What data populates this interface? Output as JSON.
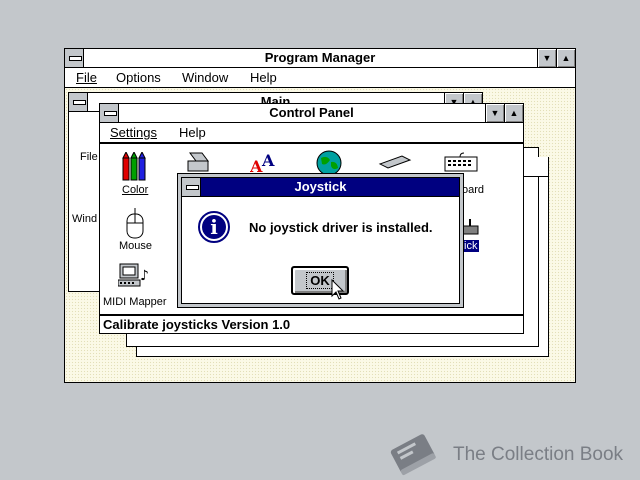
{
  "program_manager": {
    "title": "Program Manager",
    "menu": [
      "File",
      "Options",
      "Window",
      "Help"
    ]
  },
  "main_group": {
    "title": "Main",
    "partial_labels": [
      "File",
      "Wind"
    ]
  },
  "control_panel": {
    "title": "Control Panel",
    "menu": [
      "Settings",
      "Help"
    ],
    "icons": [
      "Color",
      "Mouse",
      "MIDI Mapper",
      "Keyboard",
      "Joystick"
    ],
    "status": "Calibrate joysticks Version 1.0"
  },
  "dialog": {
    "title": "Joystick",
    "message": "No joystick driver is installed.",
    "ok_label": "OK",
    "info_glyph": "i"
  },
  "partial_icon_labels": {
    "keyboard": "oard",
    "joystick": "ick"
  },
  "watermark": {
    "text": "The Collection Book",
    "icon": "book-icon"
  },
  "colors": {
    "desktop": "#c3c7cb",
    "active_title": "#000080",
    "selection": "#000080",
    "workspace": "#fbf9e6"
  }
}
